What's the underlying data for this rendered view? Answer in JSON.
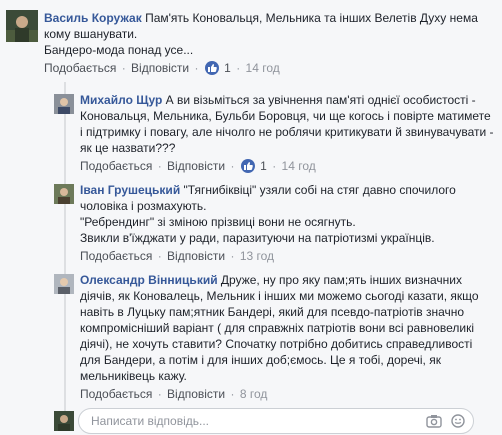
{
  "actions": {
    "like": "Подобається",
    "reply": "Відповісти",
    "dot": "·"
  },
  "comments": [
    {
      "author": "Василь Коружак",
      "text": "Пам'ять Коновальця, Мельника та інших Велетів Духу нема кому вшанувати.",
      "text2": "Бандеро-мода понад усе...",
      "likes": "1",
      "time": "14 год"
    }
  ],
  "replies": [
    {
      "author": "Михайло Щур",
      "text": "А ви візьміться за увічнення пам'яті однієї особистості - Коновальця, Мельника, Бульби Боровця, чи ще когось і повірте матимете і підтримку і повагу, але нічолго не роблячи критикувати й звинувачувати - як це назвати???",
      "likes": "1",
      "time": "14 год"
    },
    {
      "author": "Іван Грушецький",
      "text": "\"Тягнибіквіці\" узяли собі на стяг давно спочилого чоловіка і розмахують.",
      "text2": "\"Ребрендинг\" зі зміною прізвиці вони не осягнуть.",
      "text3": "Звикли в'їжджати у ради, паразитуючи на патріотизмі українців.",
      "time": "13 год"
    },
    {
      "author": "Олександр Вінницький",
      "text": "Друже, ну про яку пам;ять інших визначних діячів, як Коновалець, Мельник і інших ми можемо сьогоді казати, якщо навіть в Луцьку пам;ятник Бандері, який для псевдо-патріотів значно компромісніший варіант ( для справжніх патріотів вони всі равновеликі діячі), не хочуть ставити? Спочатку потрібно добитись справедливості для Бандери, а потім і для інших доб;ємось. Це я тобі, доречі, як мельниківець кажу.",
      "time": "8 год"
    }
  ],
  "reply_input": {
    "placeholder": "Написати відповідь..."
  },
  "icons": [
    "camera-icon",
    "emoji-icon"
  ]
}
